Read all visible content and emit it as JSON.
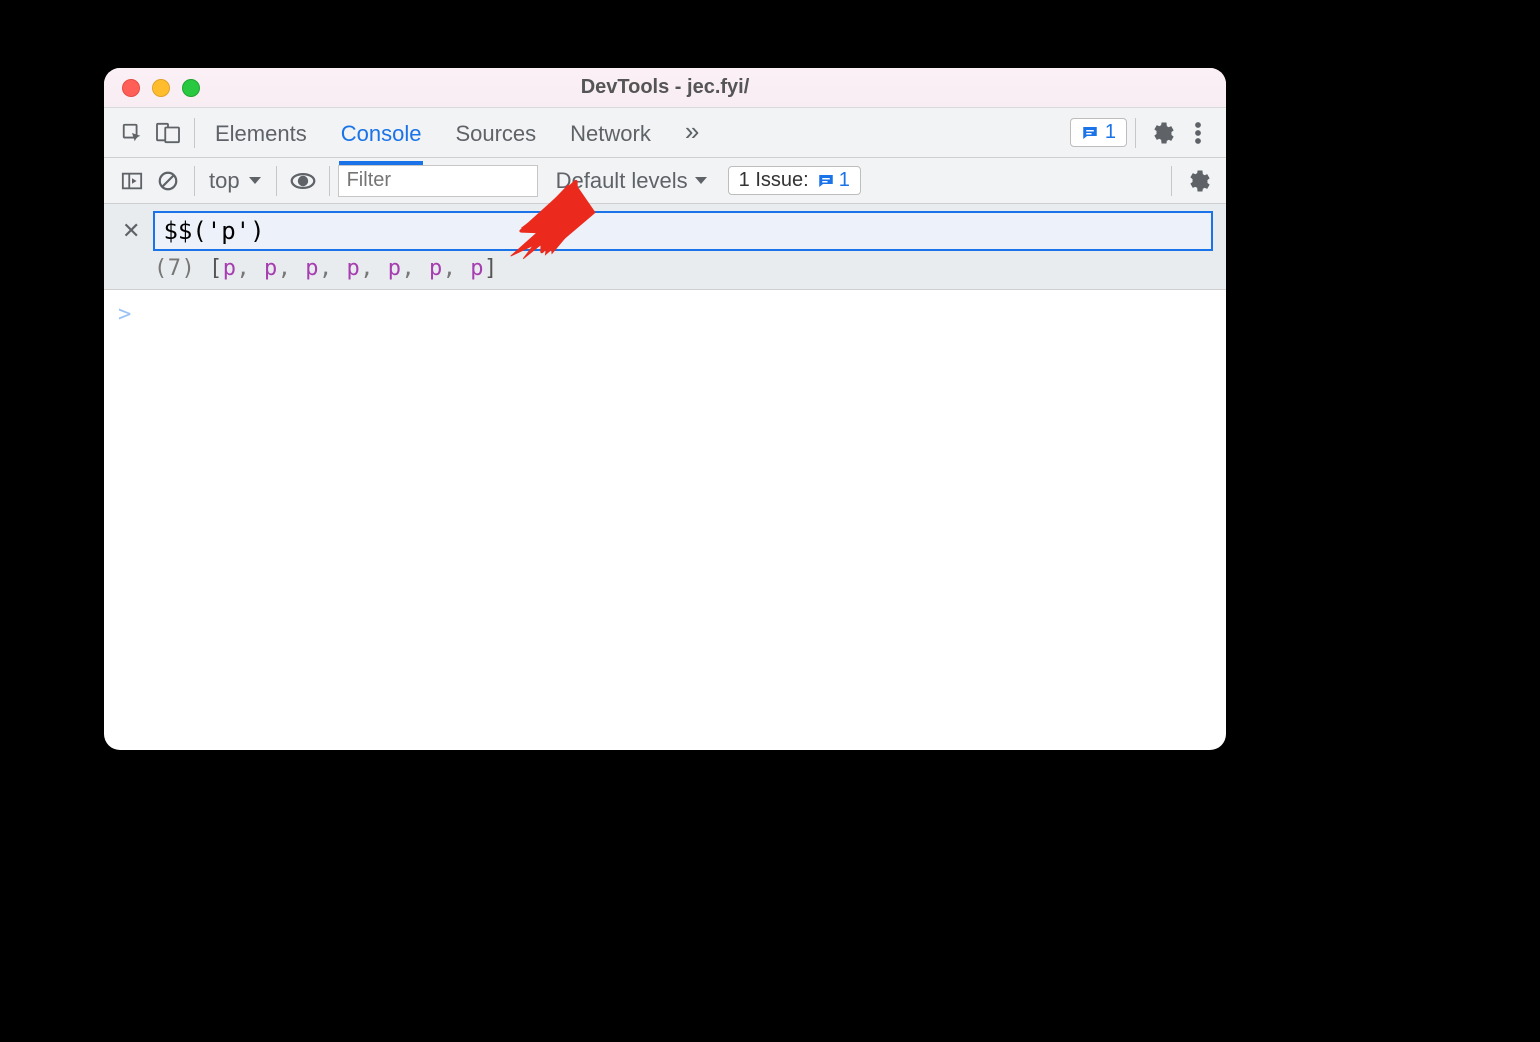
{
  "window": {
    "title": "DevTools - jec.fyi/"
  },
  "tabs": [
    "Elements",
    "Console",
    "Sources",
    "Network"
  ],
  "activeTab": "Console",
  "moreTabsGlyph": "»",
  "messages_badge_count": "1",
  "subbar": {
    "context": "top",
    "filter_placeholder": "Filter",
    "levels_label": "Default levels",
    "issues_label": "1 Issue:",
    "issues_count": "1"
  },
  "eager": {
    "input_value": "$$('p')",
    "result_count": "(7)",
    "result_open": "[",
    "result_close": "]",
    "result_items": [
      "p",
      "p",
      "p",
      "p",
      "p",
      "p",
      "p"
    ]
  },
  "prompt_caret": ">"
}
